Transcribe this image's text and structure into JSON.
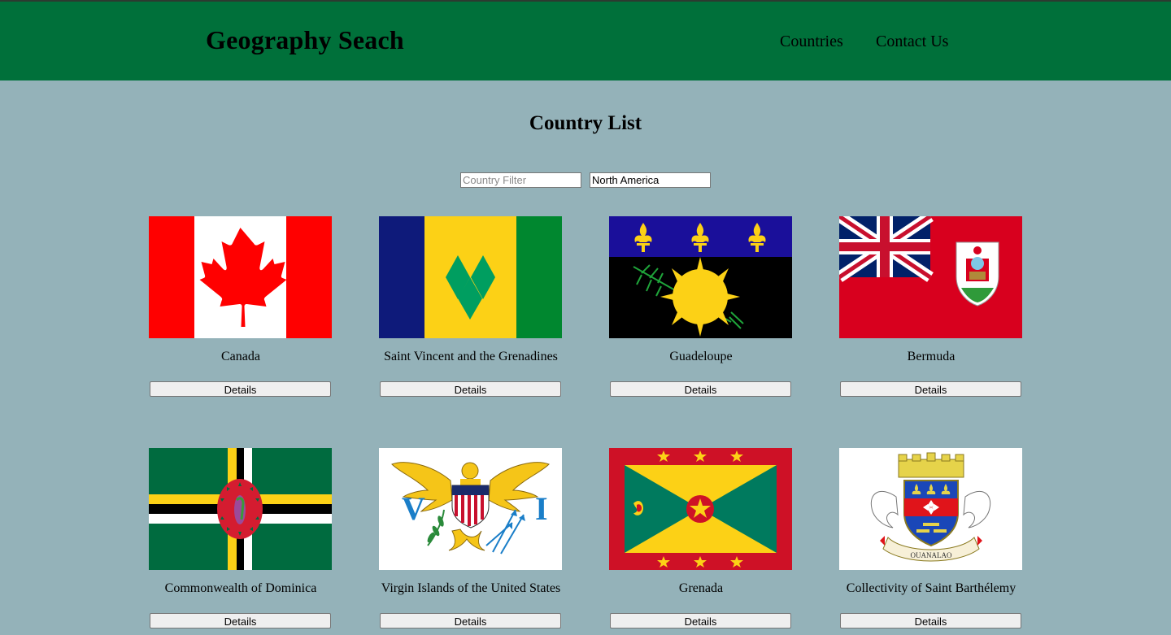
{
  "header": {
    "brand": "Geography Seach",
    "nav": [
      {
        "label": "Countries"
      },
      {
        "label": "Contact Us"
      }
    ],
    "background_color": "#00703a"
  },
  "main": {
    "title": "Country List",
    "filter": {
      "placeholder": "Country Filter",
      "value": ""
    },
    "region_select": {
      "value": "North America"
    },
    "background_color": "#94b2b9"
  },
  "countries": [
    {
      "name": "Canada",
      "button_label": "Details",
      "flag_icon": "canada-flag-icon"
    },
    {
      "name": "Saint Vincent and the Grenadines",
      "button_label": "Details",
      "flag_icon": "saint-vincent-flag-icon"
    },
    {
      "name": "Guadeloupe",
      "button_label": "Details",
      "flag_icon": "guadeloupe-flag-icon"
    },
    {
      "name": "Bermuda",
      "button_label": "Details",
      "flag_icon": "bermuda-flag-icon"
    },
    {
      "name": "Commonwealth of Dominica",
      "button_label": "Details",
      "flag_icon": "dominica-flag-icon"
    },
    {
      "name": "Virgin Islands of the United States",
      "button_label": "Details",
      "flag_icon": "us-virgin-islands-flag-icon"
    },
    {
      "name": "Grenada",
      "button_label": "Details",
      "flag_icon": "grenada-flag-icon"
    },
    {
      "name": "Collectivity of Saint Barthélemy",
      "button_label": "Details",
      "flag_icon": "saint-barthelemy-flag-icon"
    }
  ]
}
